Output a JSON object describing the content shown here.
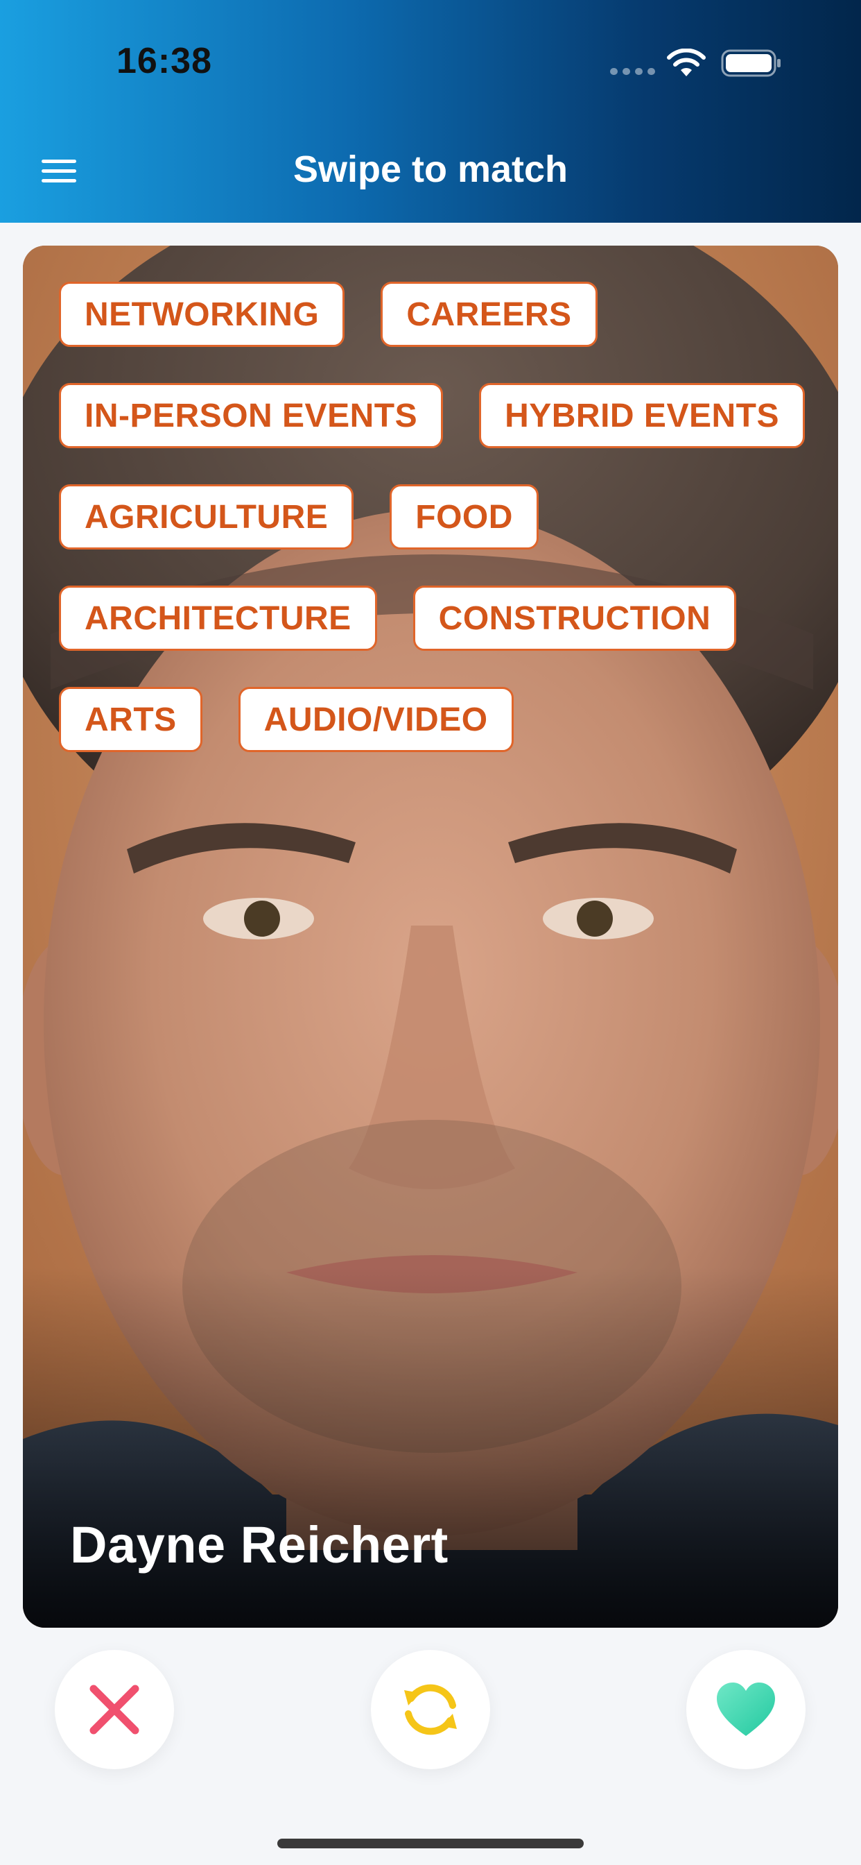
{
  "status_bar": {
    "time": "16:38"
  },
  "header": {
    "title": "Swipe to match"
  },
  "profile": {
    "name": "Dayne Reichert",
    "tag_rows": [
      [
        "NETWORKING",
        "CAREERS"
      ],
      [
        "IN-PERSON EVENTS",
        "HYBRID EVENTS"
      ],
      [
        "AGRICULTURE",
        "FOOD"
      ],
      [
        "ARCHITECTURE",
        "CONSTRUCTION"
      ],
      [
        "ARTS",
        "AUDIO/VIDEO"
      ]
    ]
  },
  "actions": {
    "nope_icon": "close-icon",
    "reload_icon": "refresh-icon",
    "like_icon": "heart-icon"
  },
  "colors": {
    "header_gradient_start": "#1a9fe0",
    "header_gradient_end": "#02264b",
    "tag_accent": "#d4561a",
    "nope": "#f0506e",
    "reload": "#f5c518",
    "like": "#3ee0b8"
  }
}
